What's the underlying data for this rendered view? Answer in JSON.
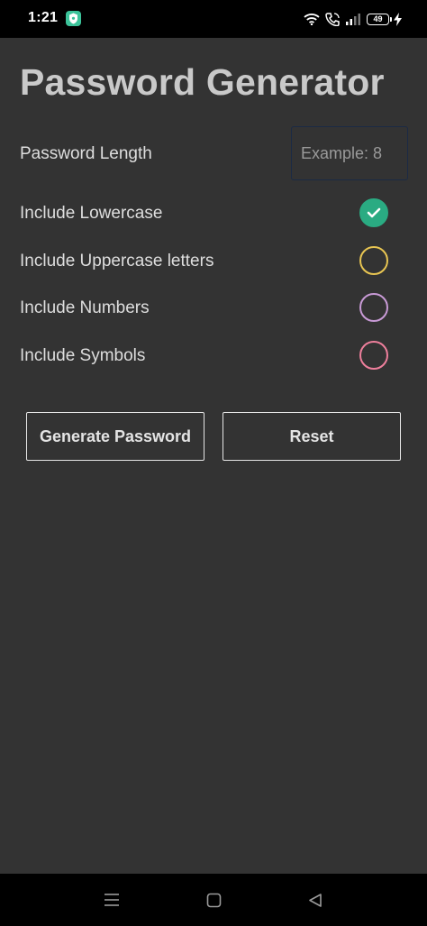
{
  "status_bar": {
    "time": "1:21",
    "battery": "49"
  },
  "title": "Password Generator",
  "length": {
    "label": "Password Length",
    "placeholder": "Example: 8",
    "value": ""
  },
  "options": [
    {
      "label": "Include Lowercase",
      "checked": true,
      "color": "#2aab82"
    },
    {
      "label": "Include Uppercase letters",
      "checked": false,
      "color": "#e8c552"
    },
    {
      "label": "Include Numbers",
      "checked": false,
      "color": "#c89ad6"
    },
    {
      "label": "Include Symbols",
      "checked": false,
      "color": "#ee7f9c"
    }
  ],
  "buttons": {
    "generate": "Generate Password",
    "reset": "Reset"
  },
  "icons": {
    "app_status": "shield-icon",
    "wifi": "wifi-icon",
    "call": "call-icon",
    "signal": "signal-icon",
    "charging": "bolt-icon",
    "check": "check-icon",
    "nav_menu": "menu-icon",
    "nav_home": "home-icon",
    "nav_back": "back-icon"
  }
}
